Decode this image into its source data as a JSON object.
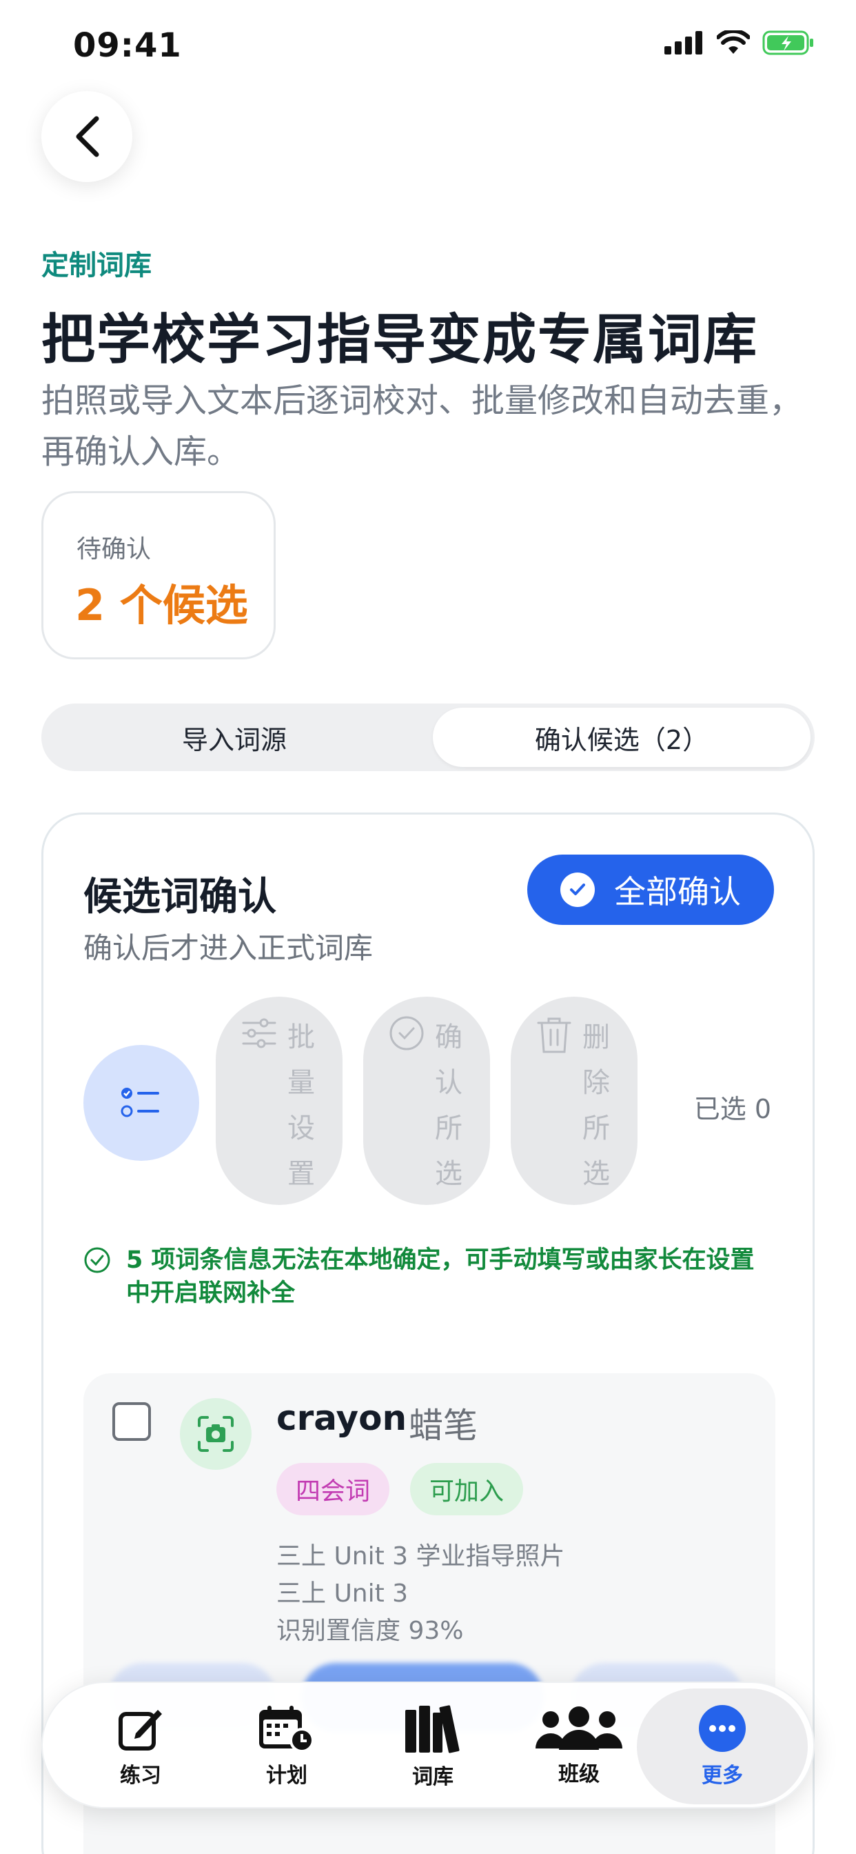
{
  "status": {
    "time": "09:41"
  },
  "header": {
    "eyebrow": "定制词库",
    "title": "把学校学习指导变成专属词库",
    "subtitle": "拍照或导入文本后逐词校对、批量修改和自动去重，再确认入库。"
  },
  "pending": {
    "label": "待确认",
    "value": "2 个候选"
  },
  "tabs": [
    {
      "label": "导入词源",
      "active": false
    },
    {
      "label": "确认候选（2）",
      "active": true
    }
  ],
  "card": {
    "title": "候选词确认",
    "subtitle": "确认后才进入正式词库",
    "confirm_all": "全部确认",
    "actions": [
      {
        "label": "批量设置",
        "icon": "sliders-icon"
      },
      {
        "label": "确认所选",
        "icon": "check-circle-icon"
      },
      {
        "label": "删除所选",
        "icon": "trash-icon"
      }
    ],
    "selected_count": "已选 0",
    "notice": "5 项词条信息无法在本地确定，可手动填写或由家长在设置中开启联网补全"
  },
  "candidate": {
    "word": "crayon",
    "meaning": "蜡笔",
    "tags": [
      "四会词",
      "可加入"
    ],
    "source": "三上 Unit 3 学业指导照片",
    "unit": "三上 Unit 3",
    "confidence": "识别置信度 93%"
  },
  "nav": [
    {
      "label": "练习",
      "icon": "edit-icon",
      "active": false
    },
    {
      "label": "计划",
      "icon": "calendar-icon",
      "active": false
    },
    {
      "label": "词库",
      "icon": "books-icon",
      "active": false
    },
    {
      "label": "班级",
      "icon": "group-icon",
      "active": false
    },
    {
      "label": "更多",
      "icon": "more-icon",
      "active": true
    }
  ],
  "colors": {
    "accent": "#2563eb",
    "teal": "#0f8a7e",
    "orange": "#ec7b14",
    "success": "#128a3c"
  }
}
